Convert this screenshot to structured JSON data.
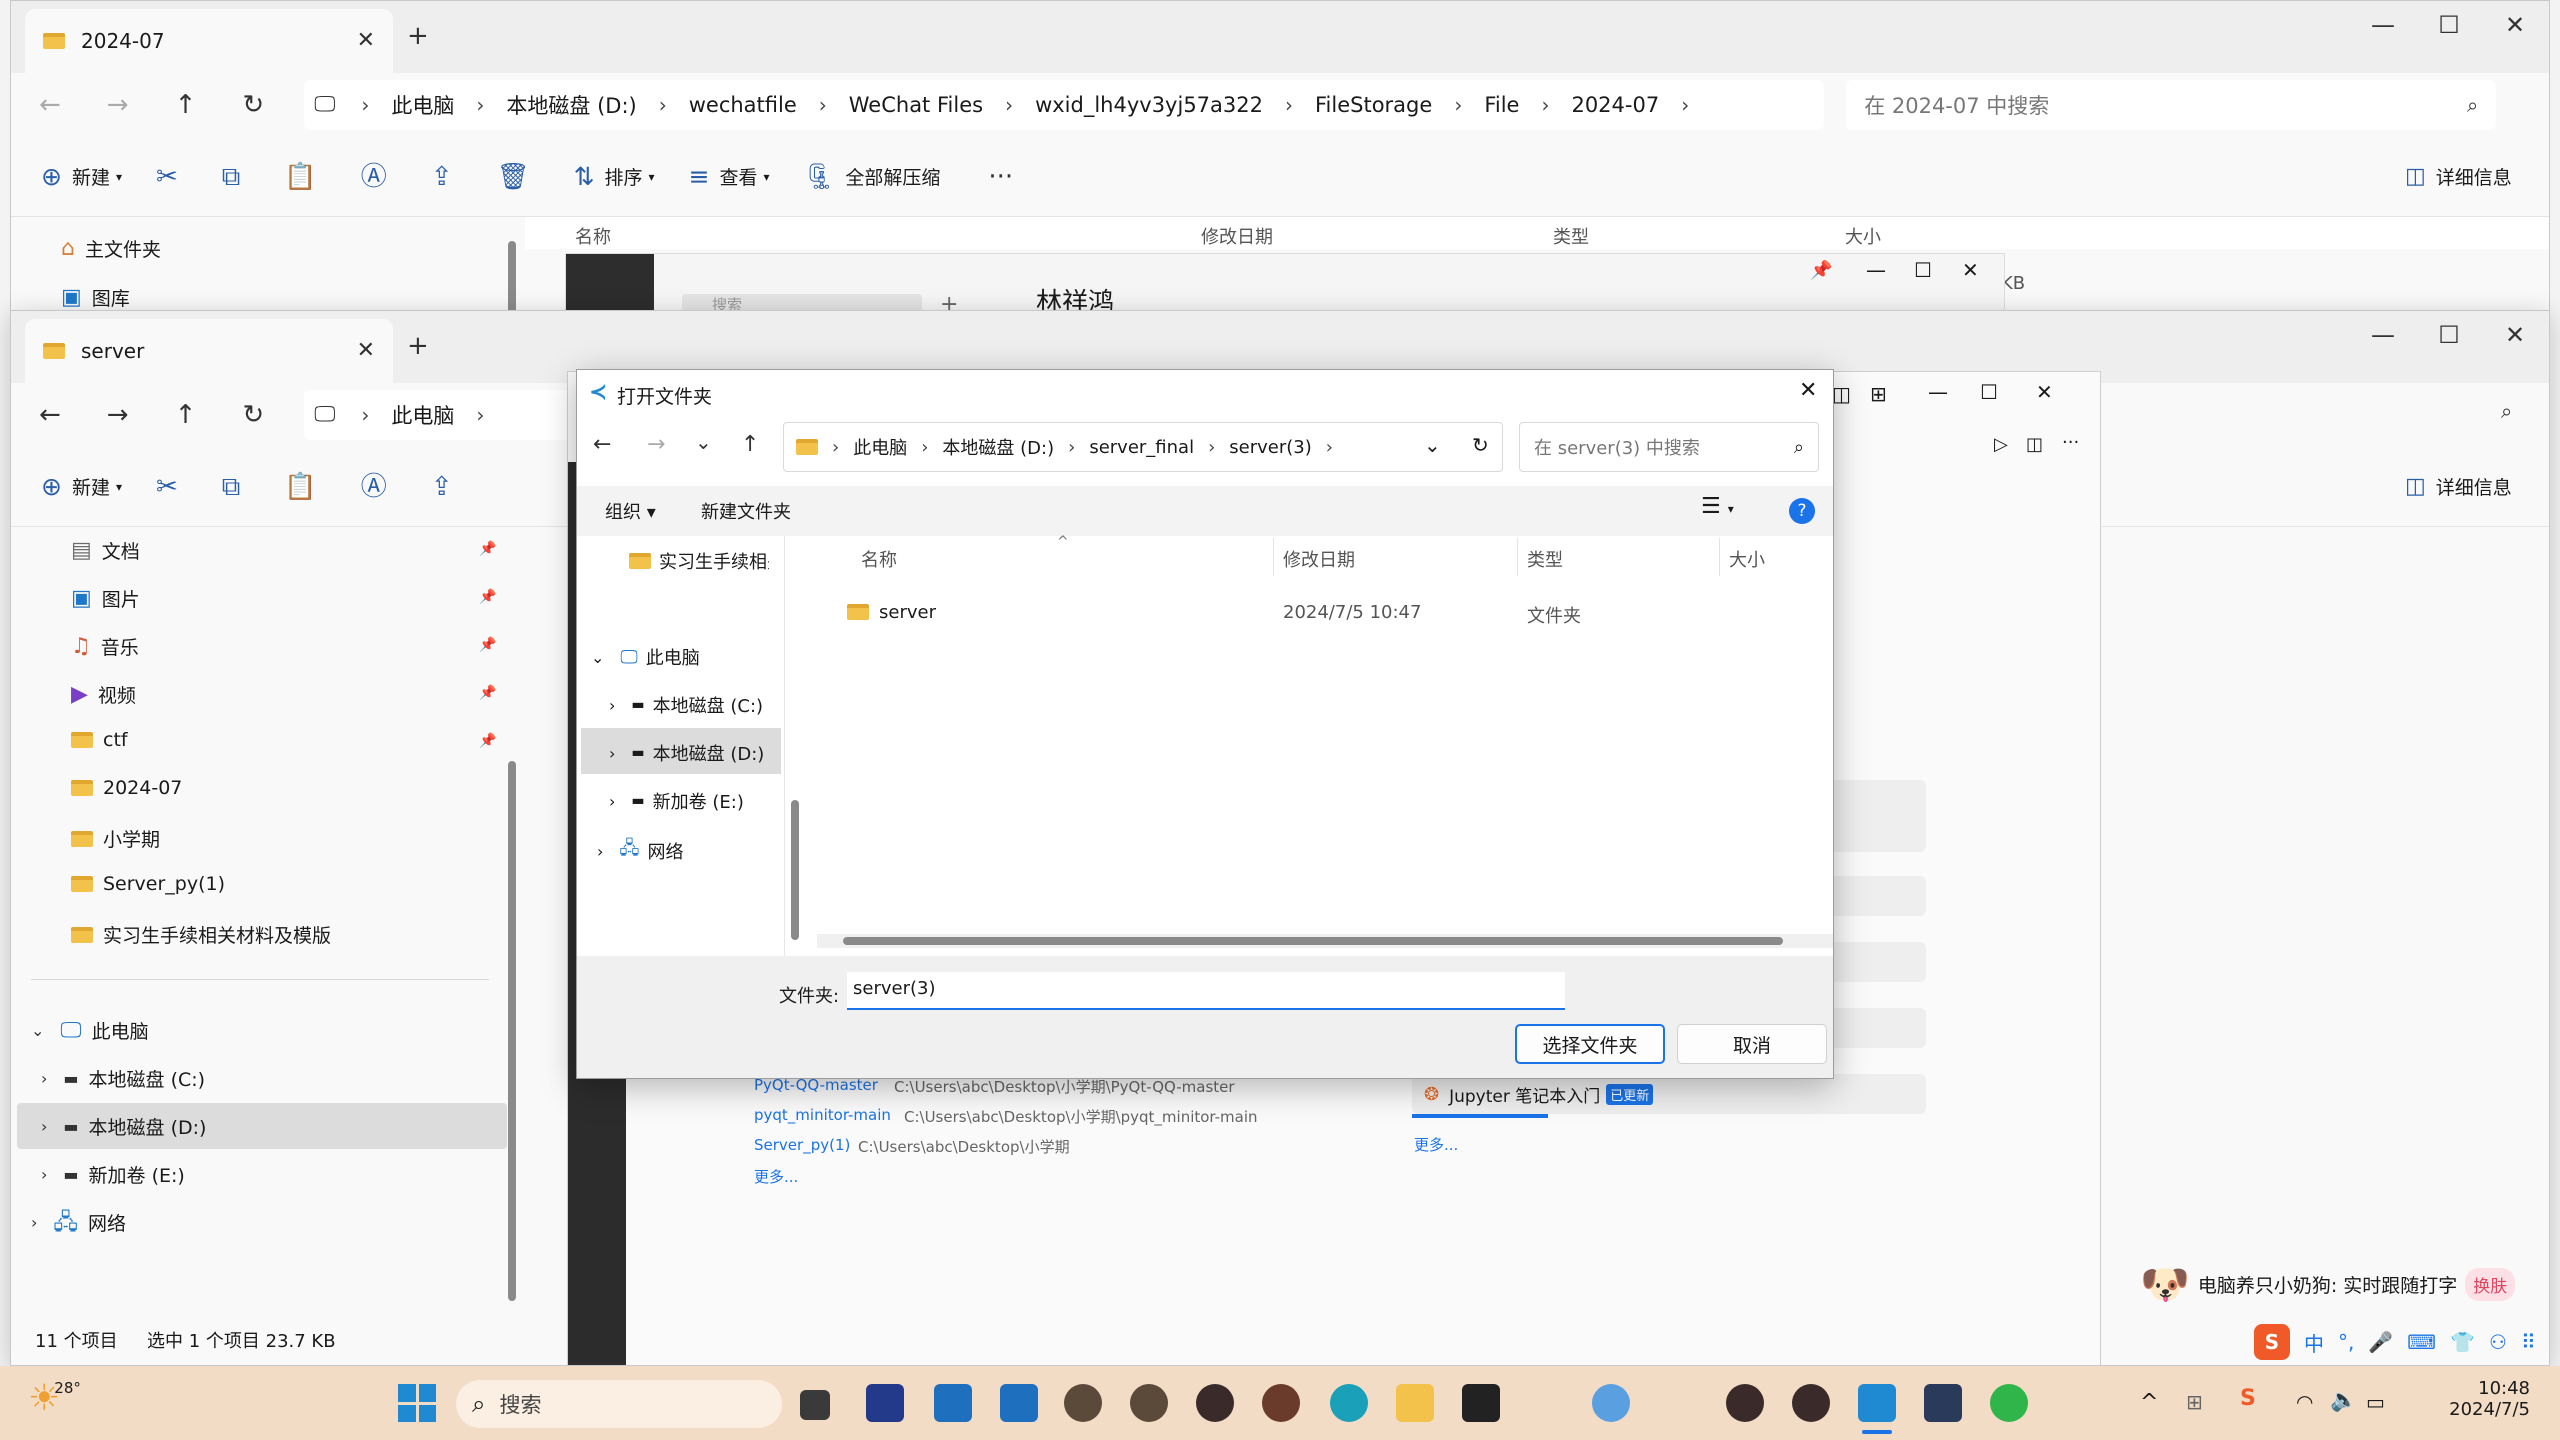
{
  "explorer_back": {
    "tab_title": "2024-07",
    "breadcrumb": [
      "此电脑",
      "本地磁盘 (D:)",
      "wechatfile",
      "WeChat Files",
      "wxid_lh4yv3yj57a322",
      "FileStorage",
      "File",
      "2024-07"
    ],
    "search_placeholder": "在 2024-07 中搜索",
    "toolbar": {
      "new": "新建",
      "sort": "排序",
      "view": "查看",
      "extract": "全部解压缩",
      "details": "详细信息"
    },
    "sidebar": [
      "主文件夹",
      "图库"
    ],
    "columns": {
      "name": "名称",
      "date": "修改日期",
      "type": "类型",
      "size": "大小"
    },
    "size_fragment": "KB",
    "popup_name": "林祥鸿",
    "popup_search": "搜索"
  },
  "explorer_front": {
    "tab_title": "server",
    "breadcrumb": [
      "此电脑"
    ],
    "toolbar": {
      "new": "新建",
      "details": "详细信息"
    },
    "quick_access": [
      "文档",
      "图片",
      "音乐",
      "视频",
      "ctf",
      "2024-07",
      "小学期",
      "Server_py(1)",
      "实习生手续相关材料及模版"
    ],
    "tree": [
      "此电脑",
      "本地磁盘 (C:)",
      "本地磁盘 (D:)",
      "新加卷 (E:)",
      "网络"
    ],
    "status_count": "11 个项目",
    "status_selected": "选中 1 个项目  23.7 KB"
  },
  "vscode_recent": [
    {
      "name": "PyQt-QQ-master",
      "path": "C:\\Users\\abc\\Desktop\\小学期\\PyQt-QQ-master"
    },
    {
      "name": "pyqt_minitor-main",
      "path": "C:\\Users\\abc\\Desktop\\小学期\\pyqt_minitor-main"
    },
    {
      "name": "Server_py(1)",
      "path": "C:\\Users\\abc\\Desktop\\小学期"
    }
  ],
  "vscode_more": "更多...",
  "vscode_walkthrough": "Jupyter 笔记本入门",
  "vscode_updated_badge": "已更新",
  "vscode_more2": "更多...",
  "dialog": {
    "title": "打开文件夹",
    "breadcrumb": [
      "此电脑",
      "本地磁盘 (D:)",
      "server_final",
      "server(3)"
    ],
    "search_placeholder": "在 server(3) 中搜索",
    "organize": "组织",
    "new_folder": "新建文件夹",
    "nav_top": "实习生手续相关",
    "tree": [
      "此电脑",
      "本地磁盘 (C:)",
      "本地磁盘 (D:)",
      "新加卷 (E:)",
      "网络"
    ],
    "columns": {
      "name": "名称",
      "date": "修改日期",
      "type": "类型",
      "size": "大小"
    },
    "rows": [
      {
        "name": "server",
        "date": "2024/7/5 10:47",
        "type": "文件夹"
      }
    ],
    "folder_label": "文件夹:",
    "folder_value": "server(3)",
    "select_button": "选择文件夹",
    "cancel_button": "取消"
  },
  "ime_tip": "电脑养只小奶狗: 实时跟随打字",
  "ime_skin": "换肤",
  "taskbar": {
    "weather": "28°",
    "search": "搜索",
    "ime_lang": "中",
    "time": "10:48",
    "date": "2024/7/5"
  }
}
